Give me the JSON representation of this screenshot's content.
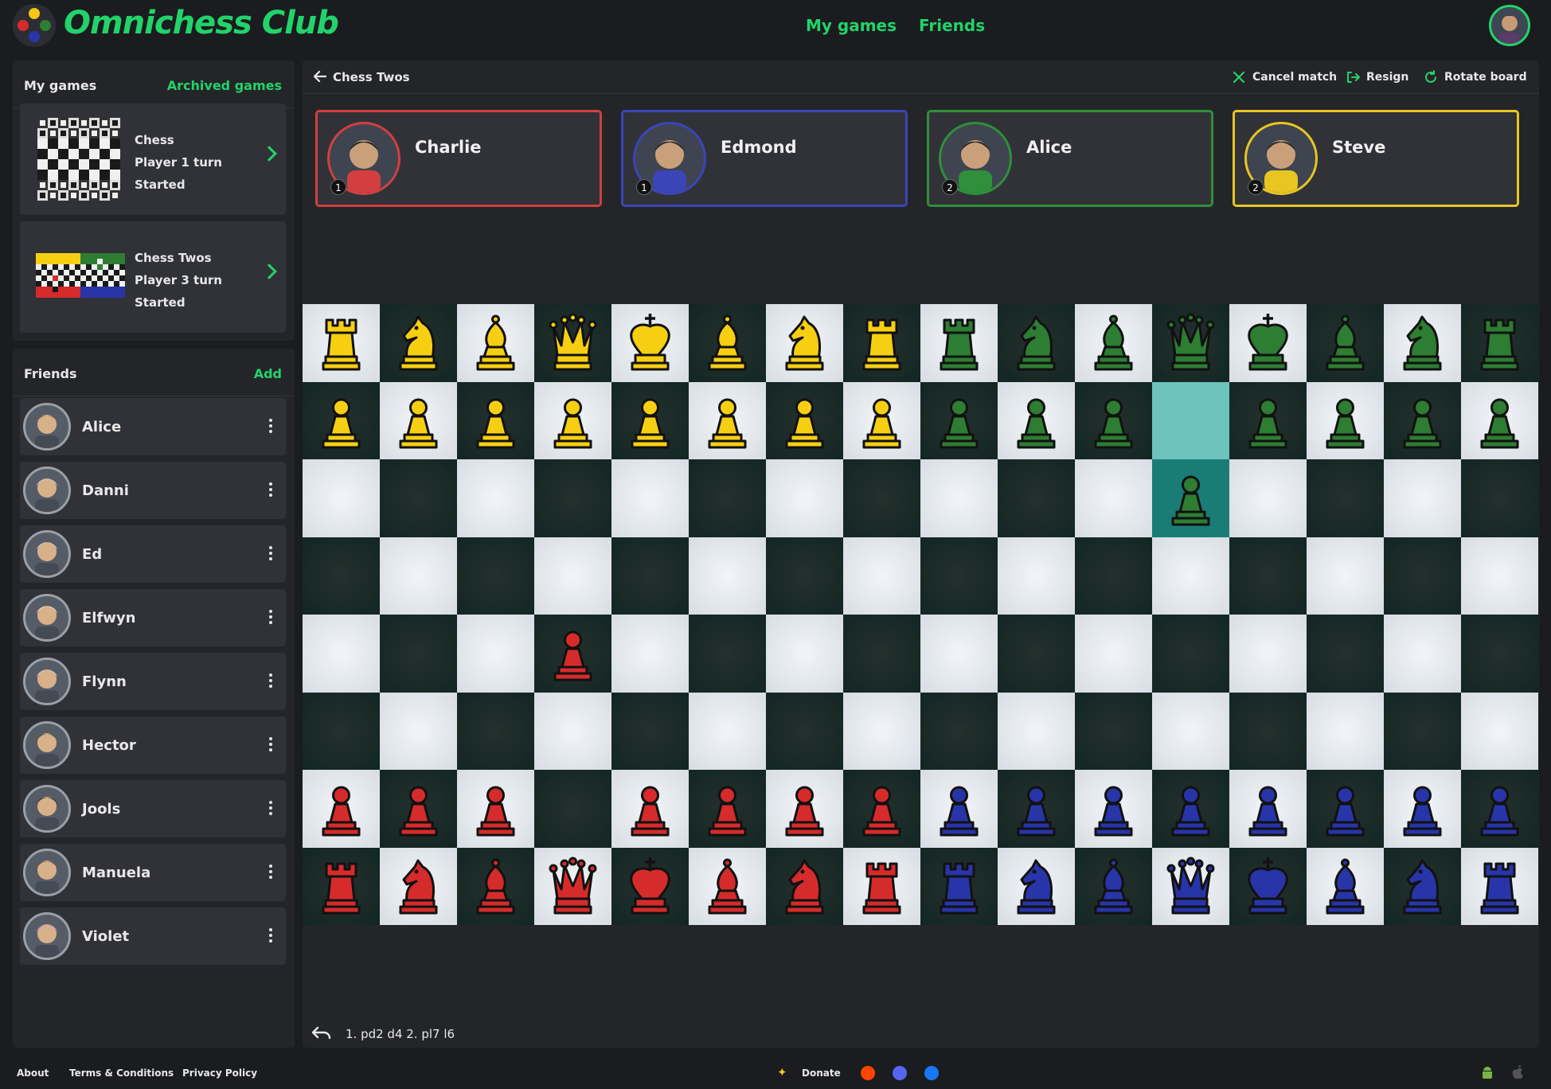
{
  "app": {
    "brand": "Omnichess Club"
  },
  "nav": {
    "my_games": "My games",
    "friends": "Friends"
  },
  "games_panel": {
    "title": "My games",
    "archived_label": "Archived games",
    "games": [
      {
        "name": "Chess",
        "turn": "Player 1 turn",
        "status": "Started"
      },
      {
        "name": "Chess Twos",
        "turn": "Player 3 turn",
        "status": "Started"
      }
    ]
  },
  "friends_panel": {
    "title": "Friends",
    "add_label": "Add",
    "friends": [
      {
        "name": "Alice",
        "color": "#8a6a4f"
      },
      {
        "name": "Danni",
        "color": "#c8ced8"
      },
      {
        "name": "Ed",
        "color": "#d0d0d0"
      },
      {
        "name": "Elfwyn",
        "color": "#e9e3d6"
      },
      {
        "name": "Flynn",
        "color": "#d9d4c8"
      },
      {
        "name": "Hector",
        "color": "#3a5a2e"
      },
      {
        "name": "Jools",
        "color": "#2b2b2b"
      },
      {
        "name": "Manuela",
        "color": "#6b4e39"
      },
      {
        "name": "Violet",
        "color": "#b58ad8"
      }
    ]
  },
  "game": {
    "title": "Chess Twos",
    "actions": {
      "cancel": "Cancel match",
      "resign": "Resign",
      "rotate": "Rotate board"
    },
    "players": [
      {
        "name": "Charlie",
        "team": "1",
        "color": "#d33f3f"
      },
      {
        "name": "Edmond",
        "team": "1",
        "color": "#3b45b8"
      },
      {
        "name": "Alice",
        "team": "2",
        "color": "#2f8f3a"
      },
      {
        "name": "Steve",
        "team": "2",
        "color": "#e8c521"
      }
    ],
    "piece_colors": {
      "y": "#f7cf12",
      "g": "#2d7d32",
      "r": "#d62b2b",
      "b": "#2835a8"
    },
    "highlight": [
      [
        1,
        11
      ],
      [
        2,
        11
      ]
    ],
    "board": [
      [
        "yR",
        "yN",
        "yB",
        "yQ",
        "yK",
        "yB",
        "yN",
        "yR",
        "gR",
        "gN",
        "gB",
        "gQ",
        "gK",
        "gB",
        "gN",
        "gR"
      ],
      [
        "yP",
        "yP",
        "yP",
        "yP",
        "yP",
        "yP",
        "yP",
        "yP",
        "gP",
        "gP",
        "gP",
        "",
        "gP",
        "gP",
        "gP",
        "gP"
      ],
      [
        "",
        "",
        "",
        "",
        "",
        "",
        "",
        "",
        "",
        "",
        "",
        "gP",
        "",
        "",
        "",
        ""
      ],
      [
        "",
        "",
        "",
        "",
        "",
        "",
        "",
        "",
        "",
        "",
        "",
        "",
        "",
        "",
        "",
        ""
      ],
      [
        "",
        "",
        "",
        "rP",
        "",
        "",
        "",
        "",
        "",
        "",
        "",
        "",
        "",
        "",
        "",
        ""
      ],
      [
        "",
        "",
        "",
        "",
        "",
        "",
        "",
        "",
        "",
        "",
        "",
        "",
        "",
        "",
        "",
        ""
      ],
      [
        "rP",
        "rP",
        "rP",
        "",
        "rP",
        "rP",
        "rP",
        "rP",
        "bP",
        "bP",
        "bP",
        "bP",
        "bP",
        "bP",
        "bP",
        "bP"
      ],
      [
        "rR",
        "rN",
        "rB",
        "rQ",
        "rK",
        "rB",
        "rN",
        "rR",
        "bR",
        "bN",
        "bB",
        "bQ",
        "bK",
        "bB",
        "bN",
        "bR"
      ]
    ],
    "moves": "1. pd2 d4  2. pl7 l6"
  },
  "footer": {
    "about": "About",
    "terms": "Terms & Conditions",
    "privacy": "Privacy Policy",
    "donate": "Donate"
  }
}
